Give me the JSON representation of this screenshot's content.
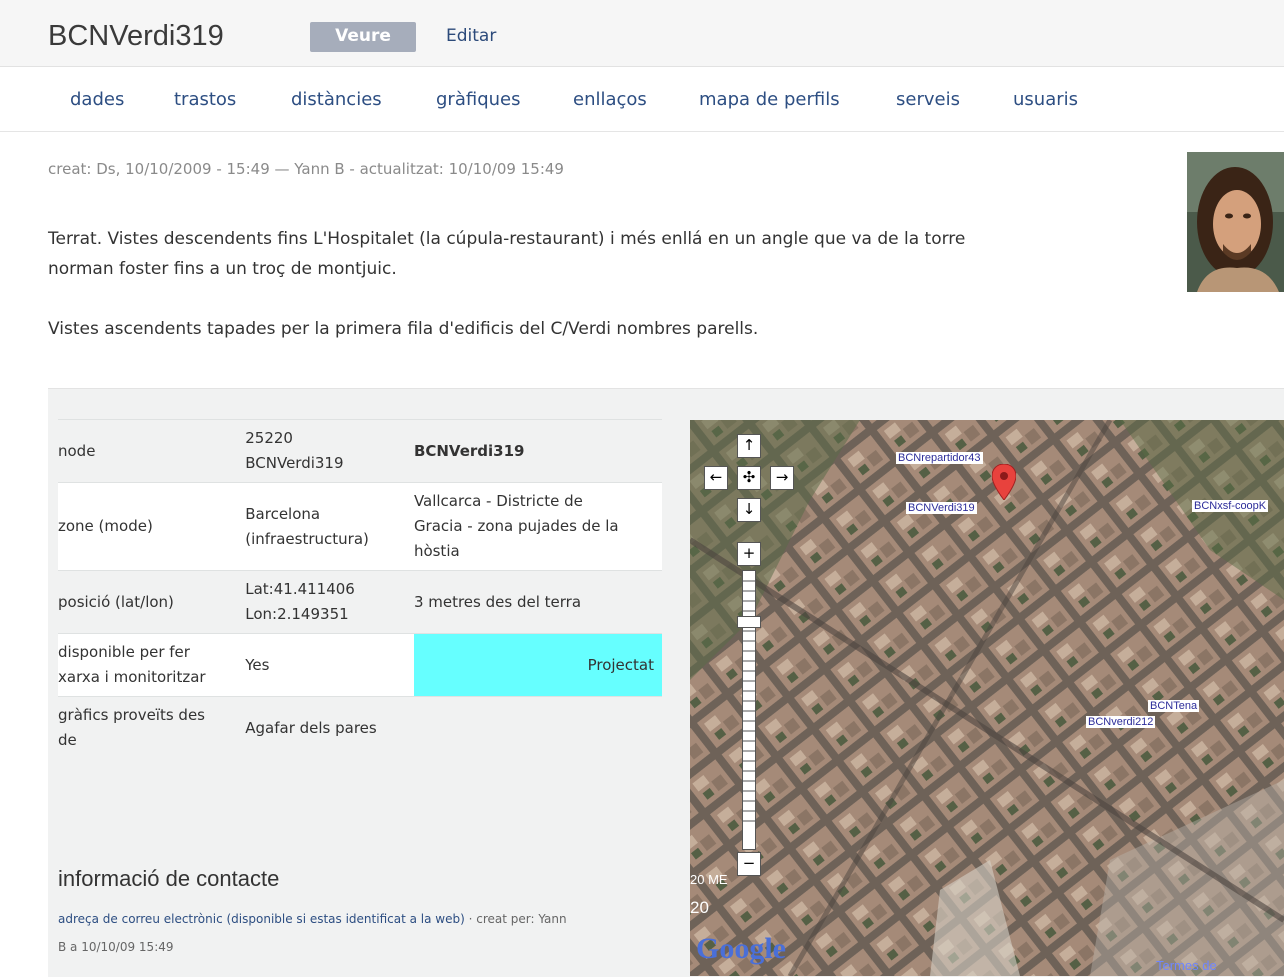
{
  "header": {
    "site_title": "BCNVerdi319",
    "tab_view": "Veure",
    "tab_edit": "Editar"
  },
  "nav": {
    "items": [
      "dades",
      "trastos",
      "distàncies",
      "gràfiques",
      "enllaços",
      "mapa de perfils",
      "serveis",
      "usuaris"
    ]
  },
  "meta": "creat: Ds, 10/10/2009 - 15:49 — Yann B - actualitzat: 10/10/09 15:49",
  "description": {
    "p1_line1": "Terrat. Vistes descendents fins L'Hospitalet (la cúpula-restaurant) i més enllá en un angle que va de la torre",
    "p1_line2": "norman foster fins a un troç de montjuic.",
    "p2": "Vistes ascendents tapades per la primera fila d'edificis del C/Verdi nombres parells."
  },
  "info_table": {
    "rows": [
      {
        "label": "node",
        "v1a": "25220",
        "v1b": "BCNVerdi319",
        "v2": "BCNVerdi319"
      },
      {
        "label": "zone (mode)",
        "v1a": "Barcelona",
        "v1b": "(infraestructura)",
        "v2a": "Vallcarca - Districte de",
        "v2b": "Gracia - zona pujades de la",
        "v2c": "hòstia"
      },
      {
        "label": "posició (lat/lon)",
        "v1a": "Lat:41.411406",
        "v1b": "Lon:2.149351",
        "v2": "3 metres des del terra"
      },
      {
        "label_a": "disponible per fer",
        "label_b": "xarxa i monitoritzar",
        "v1": "Yes",
        "v2": "Projectat"
      },
      {
        "label_a": "gràfics proveïts des",
        "label_b": "de",
        "v1": "Agafar dels pares"
      }
    ]
  },
  "contact": {
    "title": "informació de contacte",
    "email_text": "adreça de correu electrònic (disponible si estas identificat a la web)",
    "created_by": " · creat per: Yann",
    "created_by_2": "B a 10/10/09 15:49"
  },
  "map": {
    "labels": [
      "BCNrepartidor43",
      "BCNVerdi319",
      "BCNxsf-coopK",
      "BCNTena",
      "BCNverdi212"
    ],
    "scale_text": "20 ME",
    "scale_text2": "20",
    "logo": "Google",
    "terms": "Termes de"
  },
  "colors": {
    "status_projectat": "#66ffff",
    "link": "#2d4e82",
    "tab_active": "#a6adbb"
  }
}
